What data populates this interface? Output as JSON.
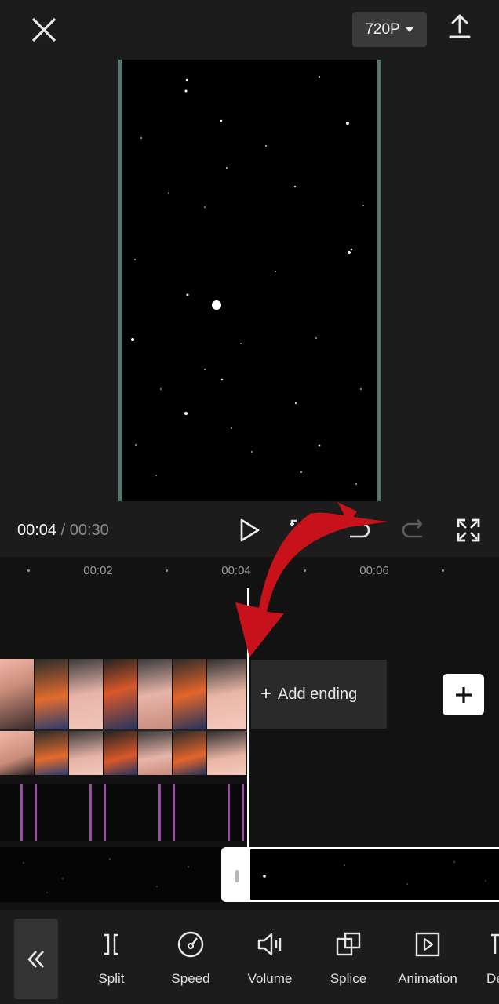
{
  "header": {
    "close_icon": "close-icon",
    "resolution": "720P",
    "export_icon": "export-icon"
  },
  "player": {
    "current_time": "00:04",
    "separator": "/",
    "total_time": "00:30"
  },
  "ruler": {
    "ticks": [
      "00:02",
      "00:04",
      "00:06"
    ]
  },
  "timeline": {
    "add_ending": "Add ending"
  },
  "toolbar": {
    "items": [
      {
        "label": "Split",
        "icon": "split-icon"
      },
      {
        "label": "Speed",
        "icon": "speed-icon"
      },
      {
        "label": "Volume",
        "icon": "volume-icon"
      },
      {
        "label": "Splice",
        "icon": "splice-icon"
      },
      {
        "label": "Animation",
        "icon": "animation-icon"
      },
      {
        "label": "De",
        "icon": "delete-icon"
      }
    ]
  },
  "colors": {
    "accent_red": "#c8121b",
    "frame_border": "#4f7a72"
  }
}
